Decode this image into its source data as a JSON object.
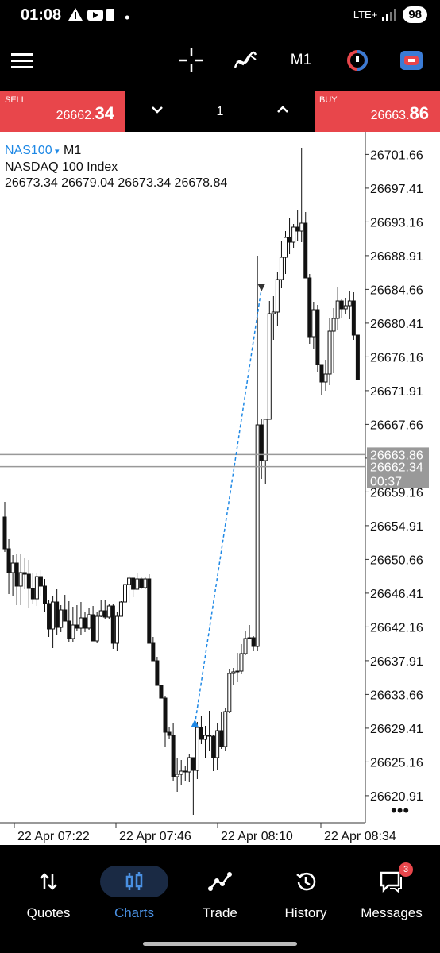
{
  "status": {
    "time": "01:08",
    "dot": "•",
    "network": "LTE+",
    "battery": "98"
  },
  "toolbar": {
    "timeframe": "M1"
  },
  "trade": {
    "sell_label": "SELL",
    "sell_main": "26662.",
    "sell_big": "34",
    "buy_label": "BUY",
    "buy_main": "26663.",
    "buy_big": "86",
    "quantity": "1"
  },
  "chart": {
    "symbol": "NAS100",
    "symbol_arrow": "▾",
    "timeframe": "M1",
    "name": "NASDAQ 100 Index",
    "ohlc": "26673.34 26679.04 26673.34 26678.84",
    "price_ticks": [
      "26701.66",
      "26697.41",
      "26693.16",
      "26688.91",
      "26684.66",
      "26680.41",
      "26676.16",
      "26671.91",
      "26667.66",
      "26663.41",
      "26659.16",
      "26654.91",
      "26650.66",
      "26646.41",
      "26642.16",
      "26637.91",
      "26633.66",
      "26629.41",
      "26625.16",
      "26620.91"
    ],
    "bid_price": "26663.86",
    "ask_price": "26662.34",
    "countdown": "00:37",
    "time_labels": [
      "22 Apr 07:22",
      "22 Apr 07:46",
      "22 Apr 08:10",
      "22 Apr 08:34"
    ],
    "more": "•••"
  },
  "chart_data": {
    "type": "candlestick",
    "symbol": "NAS100",
    "timeframe": "M1",
    "ylim": [
      26618.5,
      26703.5
    ],
    "candles_ohlc": [
      [
        26656.0,
        26657.9,
        26651.6,
        26652.0
      ],
      [
        26652.0,
        26653.2,
        26646.3,
        26649.0
      ],
      [
        26649.0,
        26651.2,
        26646.0,
        26650.2
      ],
      [
        26650.2,
        26651.4,
        26644.9,
        26647.3
      ],
      [
        26647.3,
        26651.3,
        26644.9,
        26649.0
      ],
      [
        26649.0,
        26650.9,
        26646.9,
        26648.8
      ],
      [
        26648.8,
        26650.6,
        26644.6,
        26647.0
      ],
      [
        26647.0,
        26649.0,
        26645.1,
        26645.7
      ],
      [
        26645.7,
        26648.9,
        26644.8,
        26648.5
      ],
      [
        26648.5,
        26649.3,
        26646.0,
        26647.3
      ],
      [
        26647.3,
        26648.2,
        26644.1,
        26645.1
      ],
      [
        26645.1,
        26645.5,
        26640.9,
        26641.9
      ],
      [
        26641.9,
        26646.1,
        26639.5,
        26645.3
      ],
      [
        26645.3,
        26646.9,
        26641.2,
        26642.1
      ],
      [
        26642.1,
        26644.9,
        26641.5,
        26644.3
      ],
      [
        26644.3,
        26646.2,
        26642.9,
        26642.9
      ],
      [
        26642.9,
        26645.4,
        26640.3,
        26640.7
      ],
      [
        26640.7,
        26644.7,
        26640.2,
        26642.4
      ],
      [
        26642.4,
        26644.9,
        26641.7,
        26642.0
      ],
      [
        26642.0,
        26645.3,
        26641.1,
        26643.3
      ],
      [
        26643.3,
        26644.0,
        26641.5,
        26642.0
      ],
      [
        26642.0,
        26644.6,
        26641.8,
        26643.7
      ],
      [
        26643.7,
        26644.8,
        26640.4,
        26640.4
      ],
      [
        26640.4,
        26644.1,
        26640.1,
        26643.5
      ],
      [
        26643.5,
        26645.5,
        26643.4,
        26644.2
      ],
      [
        26644.2,
        26645.5,
        26643.1,
        26643.4
      ],
      [
        26643.4,
        26645.0,
        26643.1,
        26644.8
      ],
      [
        26644.8,
        26645.0,
        26639.4,
        26640.1
      ],
      [
        26640.1,
        26644.1,
        26639.1,
        26643.5
      ],
      [
        26643.5,
        26645.4,
        26643.5,
        26645.3
      ],
      [
        26645.3,
        26648.6,
        26645.3,
        26647.5
      ],
      [
        26647.5,
        26648.6,
        26645.2,
        26648.3
      ],
      [
        26648.3,
        26648.3,
        26645.9,
        26646.9
      ],
      [
        26646.9,
        26648.9,
        26646.9,
        26648.2
      ],
      [
        26648.2,
        26648.4,
        26646.9,
        26647.1
      ],
      [
        26647.1,
        26648.4,
        26646.9,
        26648.2
      ],
      [
        26648.2,
        26648.8,
        26646.3,
        26640.1
      ],
      [
        26640.1,
        26640.9,
        26638.0,
        26637.9
      ],
      [
        26637.9,
        26638.4,
        26635.0,
        26634.8
      ],
      [
        26634.8,
        26634.9,
        26633.4,
        26633.2
      ],
      [
        26633.2,
        26633.5,
        26627.1,
        26628.9
      ],
      [
        26628.9,
        26629.6,
        26628.1,
        26628.5
      ],
      [
        26628.5,
        26630.1,
        26622.7,
        26623.3
      ],
      [
        26623.3,
        26625.7,
        26621.4,
        26623.6
      ],
      [
        26623.6,
        26625.4,
        26622.2,
        26624.0
      ],
      [
        26624.0,
        26624.7,
        26622.8,
        26623.9
      ],
      [
        26623.9,
        26626.2,
        26622.6,
        26625.7
      ],
      [
        26625.7,
        26625.6,
        26618.5,
        26624.1
      ],
      [
        26624.1,
        26630.2,
        26623.0,
        26629.5
      ],
      [
        26629.5,
        26631.0,
        26627.4,
        26628.0
      ],
      [
        26628.0,
        26629.7,
        26625.7,
        26628.5
      ],
      [
        26628.5,
        26631.6,
        26626.5,
        26628.4
      ],
      [
        26628.4,
        26628.6,
        26624.0,
        26625.7
      ],
      [
        26625.7,
        26630.0,
        26624.2,
        26629.1
      ],
      [
        26629.1,
        26631.4,
        26626.8,
        26627.1
      ],
      [
        26627.1,
        26632.0,
        26626.5,
        26631.5
      ],
      [
        26631.5,
        26636.8,
        26631.3,
        26636.3
      ],
      [
        26636.3,
        26637.0,
        26634.9,
        26636.5
      ],
      [
        26636.5,
        26638.9,
        26635.2,
        26636.6
      ],
      [
        26636.6,
        26640.0,
        26636.2,
        26638.8
      ],
      [
        26638.8,
        26641.7,
        26638.6,
        26640.7
      ],
      [
        26640.7,
        26642.4,
        26640.6,
        26640.8
      ],
      [
        26640.8,
        26641.0,
        26639.1,
        26639.7
      ],
      [
        26639.7,
        26688.9,
        26639.1,
        26667.6
      ],
      [
        26667.6,
        26668.3,
        26660.8,
        26663.1
      ],
      [
        26663.1,
        26668.4,
        26660.2,
        26668.3
      ],
      [
        26668.3,
        26683.2,
        26668.3,
        26681.6
      ],
      [
        26681.6,
        26683.8,
        26678.3,
        26681.8
      ],
      [
        26681.8,
        26686.8,
        26680.0,
        26685.9
      ],
      [
        26685.9,
        26690.8,
        26684.8,
        26688.7
      ],
      [
        26688.7,
        26692.0,
        26686.6,
        26691.2
      ],
      [
        26691.2,
        26693.6,
        26689.1,
        26690.6
      ],
      [
        26690.6,
        26692.9,
        26689.9,
        26692.5
      ],
      [
        26692.5,
        26694.7,
        26690.8,
        26692.0
      ],
      [
        26692.0,
        26702.5,
        26690.6,
        26693.0
      ],
      [
        26693.0,
        26694.4,
        26686.3,
        26686.1
      ],
      [
        26686.1,
        26686.6,
        26677.8,
        26678.7
      ],
      [
        26678.7,
        26683.1,
        26677.1,
        26682.1
      ],
      [
        26682.1,
        26682.7,
        26674.2,
        26675.2
      ],
      [
        26675.2,
        26675.2,
        26671.4,
        26673.0
      ],
      [
        26673.0,
        26675.8,
        26671.9,
        26674.0
      ],
      [
        26674.0,
        26681.0,
        26672.6,
        26679.4
      ],
      [
        26679.4,
        26682.3,
        26674.1,
        26681.0
      ],
      [
        26681.0,
        26685.0,
        26679.6,
        26683.2
      ],
      [
        26683.2,
        26683.5,
        26681.0,
        26682.2
      ],
      [
        26682.2,
        26683.6,
        26681.6,
        26682.6
      ],
      [
        26682.6,
        26684.5,
        26680.9,
        26683.2
      ],
      [
        26683.2,
        26684.3,
        26678.3,
        26678.9
      ],
      [
        26678.9,
        26678.9,
        26673.3,
        26673.3
      ]
    ],
    "position_entry": {
      "price": 26629.9,
      "direction": "buy"
    },
    "position_exit": {
      "price": 26684.8,
      "direction": "sell"
    },
    "bid": 26663.86,
    "ask": 26662.34
  }
}
